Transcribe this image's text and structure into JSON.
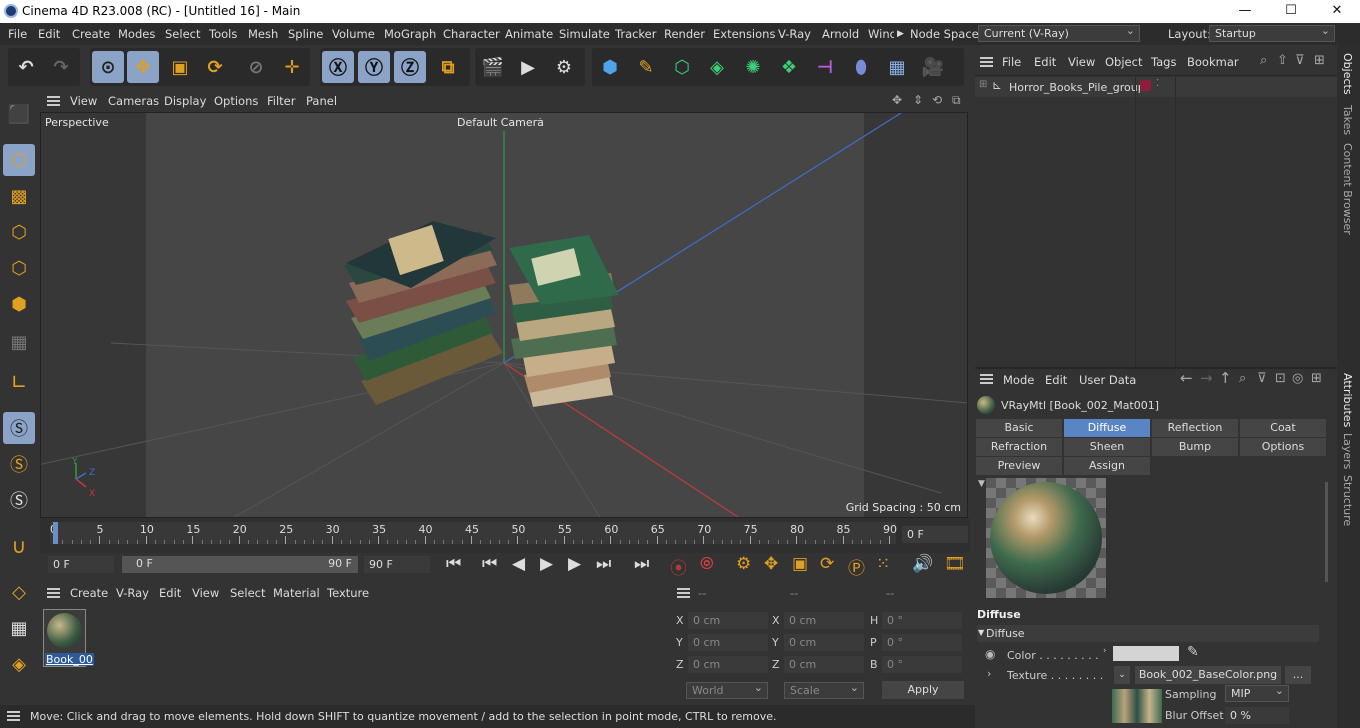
{
  "window": {
    "title": "Cinema 4D R23.008 (RC) - [Untitled 16] - Main",
    "min": "—",
    "max": "☐",
    "close": "✕"
  },
  "menu": [
    "File",
    "Edit",
    "Create",
    "Modes",
    "Select",
    "Tools",
    "Mesh",
    "Spline",
    "Volume",
    "MoGraph",
    "Character",
    "Animate",
    "Simulate",
    "Tracker",
    "Render",
    "Extensions",
    "V-Ray",
    "Arnold",
    "Wind"
  ],
  "node_space": {
    "label": "Node Space:",
    "value": "Current (V-Ray)"
  },
  "layout": {
    "label": "Layout:",
    "value": "Startup"
  },
  "viewport": {
    "menu": [
      "View",
      "Cameras",
      "Display",
      "Options",
      "Filter",
      "Panel"
    ],
    "view_label": "Perspective",
    "camera_label": "Default Camera",
    "grid_spacing": "Grid Spacing : 50 cm",
    "axes": {
      "y": "Y",
      "z": "Z",
      "x": "X"
    }
  },
  "timeline": {
    "ticks": [
      "0",
      "5",
      "10",
      "15",
      "20",
      "25",
      "30",
      "35",
      "40",
      "45",
      "50",
      "55",
      "60",
      "65",
      "70",
      "75",
      "80",
      "85",
      "90"
    ],
    "current": "0 F"
  },
  "transport": {
    "start": "0 F",
    "range_start": "0 F",
    "range_end": "90 F",
    "end": "90 F"
  },
  "material_manager": {
    "menu": [
      "Create",
      "V-Ray",
      "Edit",
      "View",
      "Select",
      "Material",
      "Texture"
    ],
    "material_name": "Book_00"
  },
  "coords": {
    "header": [
      "--",
      "--",
      "--"
    ],
    "rows": [
      {
        "a": "X",
        "av": "0 cm",
        "b": "X",
        "bv": "0 cm",
        "c": "H",
        "cv": "0 °"
      },
      {
        "a": "Y",
        "av": "0 cm",
        "b": "Y",
        "bv": "0 cm",
        "c": "P",
        "cv": "0 °"
      },
      {
        "a": "Z",
        "av": "0 cm",
        "b": "Z",
        "bv": "0 cm",
        "c": "B",
        "cv": "0 °"
      }
    ],
    "world": "World",
    "scale": "Scale",
    "apply": "Apply"
  },
  "status": "Move: Click and drag to move elements. Hold down SHIFT to quantize movement / add to the selection in point mode, CTRL to remove.",
  "objects": {
    "menu": [
      "File",
      "Edit",
      "View",
      "Object",
      "Tags",
      "Bookmarks"
    ],
    "item": "Horror_Books_Pile_group",
    "tag_color": "#8a1f3a"
  },
  "attributes": {
    "menu": [
      "Mode",
      "Edit",
      "User Data"
    ],
    "material": "VRayMtl [Book_002_Mat001]",
    "tabs": [
      "Basic",
      "Diffuse",
      "Reflection",
      "Coat",
      "Refraction",
      "Sheen",
      "Bump",
      "Options",
      "Preview Settings",
      "Assign"
    ],
    "active_tab": "Diffuse",
    "section": "Diffuse",
    "subsection": "Diffuse",
    "color_label": "Color . . . . . . . . .",
    "texture_label": "Texture . . . . . . . .",
    "texture_file": "Book_002_BaseColor.png",
    "texture_more": "...",
    "sampling_label": "Sampling",
    "sampling_value": "MIP",
    "blur_label": "Blur Offset",
    "blur_value": "0 %"
  },
  "right_tabs": [
    "Objects",
    "Takes",
    "Content Browser",
    "Attributes",
    "Layers",
    "Structure"
  ],
  "colors": {
    "accent": "#8aa3c7",
    "active_tab": "#5a85c4",
    "grid_green": "#2e9d4c",
    "axis_red": "#c23a3a",
    "axis_blue": "#3f6fc9"
  }
}
